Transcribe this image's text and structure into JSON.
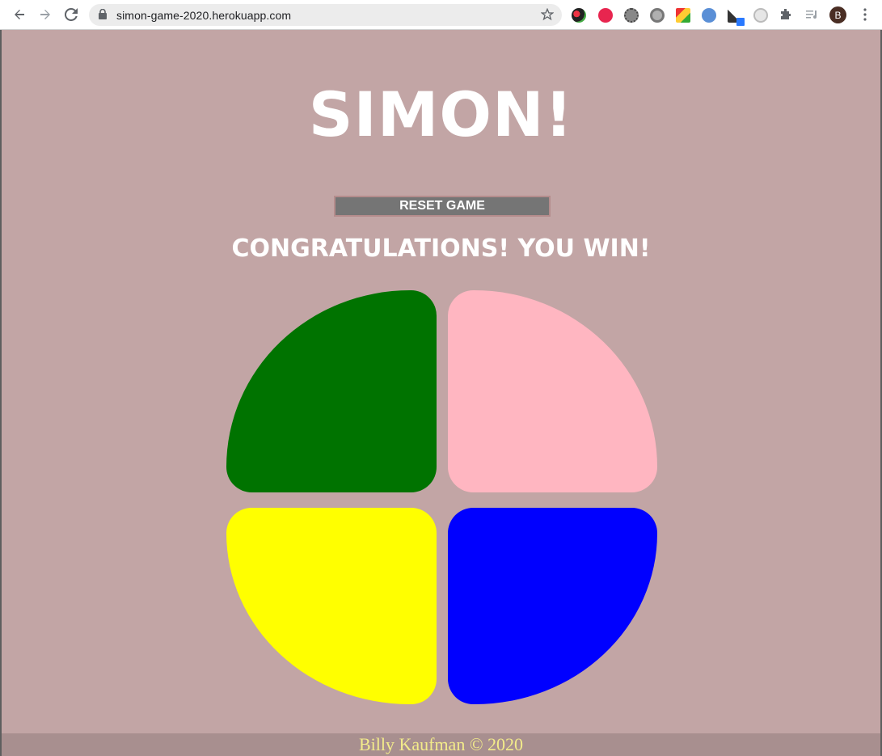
{
  "browser": {
    "url": "simon-game-2020.herokuapp.com",
    "profile_initial": "B"
  },
  "colors": {
    "page_bg": "#c2a5a5",
    "green": "#007300",
    "pink": "#ffb6c1",
    "yellow": "#ffff00",
    "blue": "#0000ff",
    "button_bg": "#757575",
    "footer_bg": "#a88f8f",
    "footer_text": "#f3ec8a"
  },
  "game": {
    "title": "SIMON!",
    "reset_label": "RESET GAME",
    "message": "CONGRATULATIONS! YOU WIN!"
  },
  "footer": {
    "text": "Billy Kaufman © 2020"
  }
}
